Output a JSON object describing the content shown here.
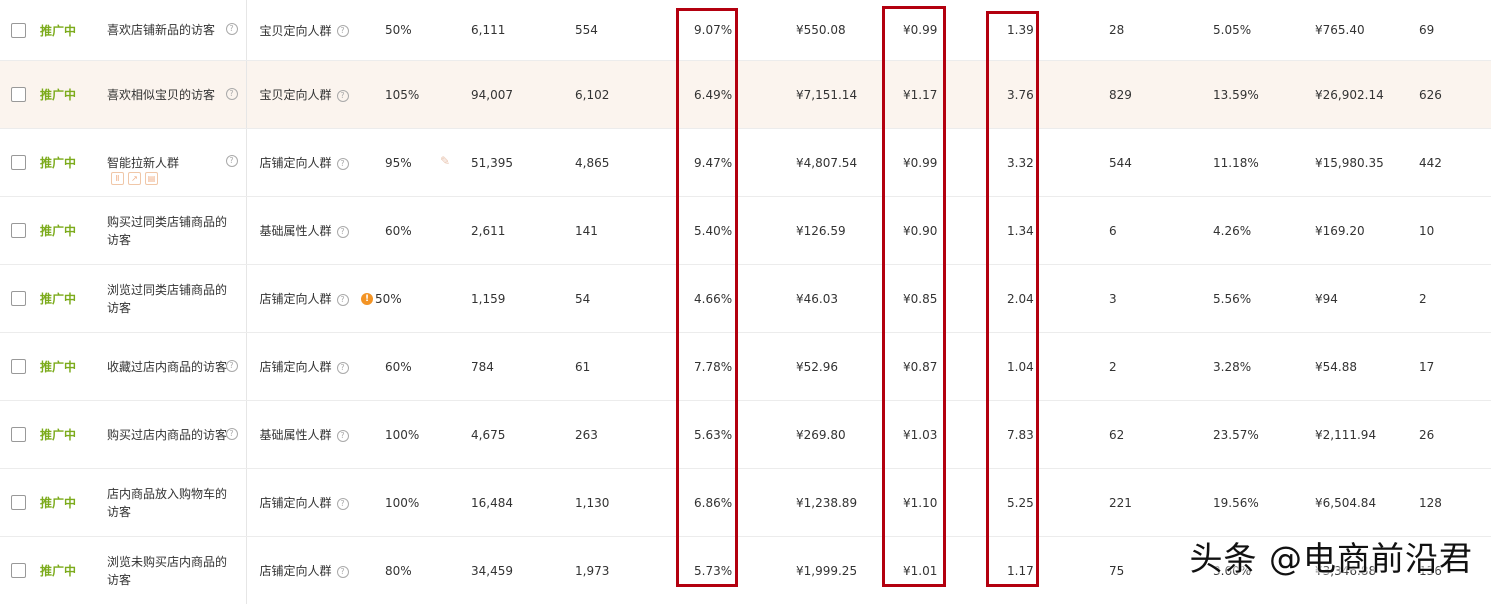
{
  "colors": {
    "status": "#7cab1c",
    "highlight_row": "#fbf4ee",
    "frame_red": "#b3000f"
  },
  "rows": [
    {
      "status": "推广中",
      "name": "喜欢店铺新品的访客",
      "type": "宝贝定向人群",
      "premium": "50%",
      "impressions": "6,111",
      "clicks": "554",
      "ctr": "9.07%",
      "cost": "¥550.08",
      "cpc": "¥0.99",
      "roi": "1.39",
      "orders": "28",
      "cvr": "5.05%",
      "gmv": "¥765.40",
      "col14": "69"
    },
    {
      "status": "推广中",
      "name": "喜欢相似宝贝的访客",
      "type": "宝贝定向人群",
      "premium": "105%",
      "impressions": "94,007",
      "clicks": "6,102",
      "ctr": "6.49%",
      "cost": "¥7,151.14",
      "cpc": "¥1.17",
      "roi": "3.76",
      "orders": "829",
      "cvr": "13.59%",
      "gmv": "¥26,902.14",
      "col14": "626"
    },
    {
      "status": "推广中",
      "name": "智能拉新人群",
      "type": "店铺定向人群",
      "premium": "95%",
      "impressions": "51,395",
      "clicks": "4,865",
      "ctr": "9.47%",
      "cost": "¥4,807.54",
      "cpc": "¥0.99",
      "roi": "3.32",
      "orders": "544",
      "cvr": "11.18%",
      "gmv": "¥15,980.35",
      "col14": "442"
    },
    {
      "status": "推广中",
      "name": "购买过同类店铺商品的访客",
      "type": "基础属性人群",
      "premium": "60%",
      "impressions": "2,611",
      "clicks": "141",
      "ctr": "5.40%",
      "cost": "¥126.59",
      "cpc": "¥0.90",
      "roi": "1.34",
      "orders": "6",
      "cvr": "4.26%",
      "gmv": "¥169.20",
      "col14": "10"
    },
    {
      "status": "推广中",
      "name": "浏览过同类店铺商品的访客",
      "type": "店铺定向人群",
      "premium": "50%",
      "impressions": "1,159",
      "clicks": "54",
      "ctr": "4.66%",
      "cost": "¥46.03",
      "cpc": "¥0.85",
      "roi": "2.04",
      "orders": "3",
      "cvr": "5.56%",
      "gmv": "¥94",
      "col14": "2"
    },
    {
      "status": "推广中",
      "name": "收藏过店内商品的访客",
      "type": "店铺定向人群",
      "premium": "60%",
      "impressions": "784",
      "clicks": "61",
      "ctr": "7.78%",
      "cost": "¥52.96",
      "cpc": "¥0.87",
      "roi": "1.04",
      "orders": "2",
      "cvr": "3.28%",
      "gmv": "¥54.88",
      "col14": "17"
    },
    {
      "status": "推广中",
      "name": "购买过店内商品的访客",
      "type": "基础属性人群",
      "premium": "100%",
      "impressions": "4,675",
      "clicks": "263",
      "ctr": "5.63%",
      "cost": "¥269.80",
      "cpc": "¥1.03",
      "roi": "7.83",
      "orders": "62",
      "cvr": "23.57%",
      "gmv": "¥2,111.94",
      "col14": "26"
    },
    {
      "status": "推广中",
      "name": "店内商品放入购物车的访客",
      "type": "店铺定向人群",
      "premium": "100%",
      "impressions": "16,484",
      "clicks": "1,130",
      "ctr": "6.86%",
      "cost": "¥1,238.89",
      "cpc": "¥1.10",
      "roi": "5.25",
      "orders": "221",
      "cvr": "19.56%",
      "gmv": "¥6,504.84",
      "col14": "128"
    },
    {
      "status": "推广中",
      "name": "浏览未购买店内商品的访客",
      "type": "店铺定向人群",
      "premium": "80%",
      "impressions": "34,459",
      "clicks": "1,973",
      "ctr": "5.73%",
      "cost": "¥1,999.25",
      "cpc": "¥1.01",
      "roi": "1.17",
      "orders": "75",
      "cvr": "3.60%",
      "gmv": "¥3,346.88",
      "col14": "136"
    }
  ],
  "watermark": "头条 @电商前沿君"
}
